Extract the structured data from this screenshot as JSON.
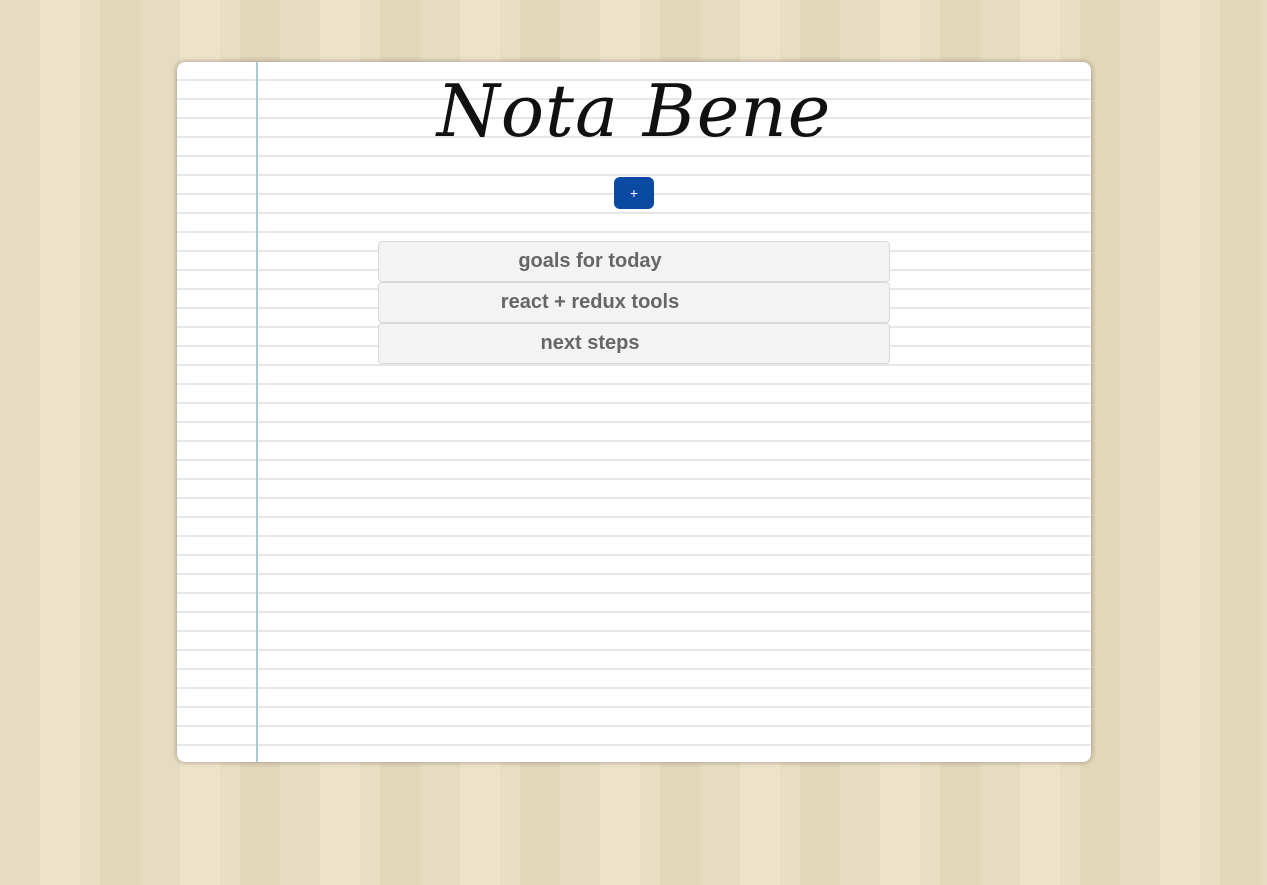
{
  "app": {
    "title": "Nota Bene"
  },
  "toolbar": {
    "add_label": "+"
  },
  "notes": [
    {
      "title": "goals for today"
    },
    {
      "title": "react + redux tools"
    },
    {
      "title": "next steps"
    }
  ],
  "colors": {
    "accent": "#0a4aa3",
    "margin_line": "#a8cbd6",
    "note_text": "#666666"
  }
}
